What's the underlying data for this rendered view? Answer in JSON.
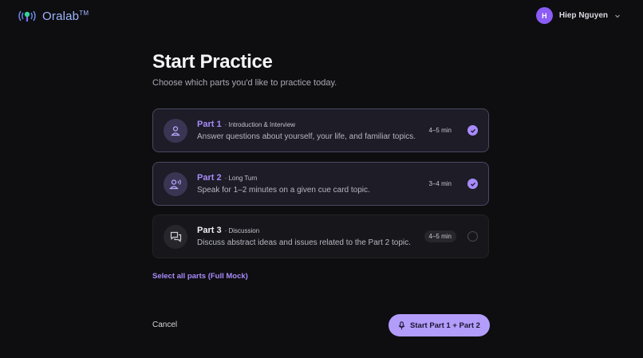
{
  "brand": {
    "name": "Oralab",
    "tm": "TM"
  },
  "user": {
    "initial": "H",
    "name": "Hiep Nguyen"
  },
  "page": {
    "title": "Start Practice",
    "subtitle": "Choose which parts you'd like to practice today."
  },
  "parts": [
    {
      "name": "Part 1",
      "tag": "· Introduction & Interview",
      "desc": "Answer questions about yourself, your life, and familiar topics.",
      "duration": "4–5 min",
      "selected": true,
      "icon": "person-icon"
    },
    {
      "name": "Part 2",
      "tag": "· Long Turn",
      "desc": "Speak for 1–2 minutes on a given cue card topic.",
      "duration": "3–4 min",
      "selected": true,
      "icon": "person-speaking-icon"
    },
    {
      "name": "Part 3",
      "tag": "· Discussion",
      "desc": "Discuss abstract ideas and issues related to the Part 2 topic.",
      "duration": "4–5 min",
      "selected": false,
      "icon": "chat-bubbles-icon"
    }
  ],
  "actions": {
    "select_all": "Select all parts (Full Mock)",
    "cancel": "Cancel",
    "start": "Start Part 1 + Part 2"
  },
  "colors": {
    "accent": "#a78bfa",
    "button": "#b39dfb",
    "background": "#0e0e11"
  }
}
